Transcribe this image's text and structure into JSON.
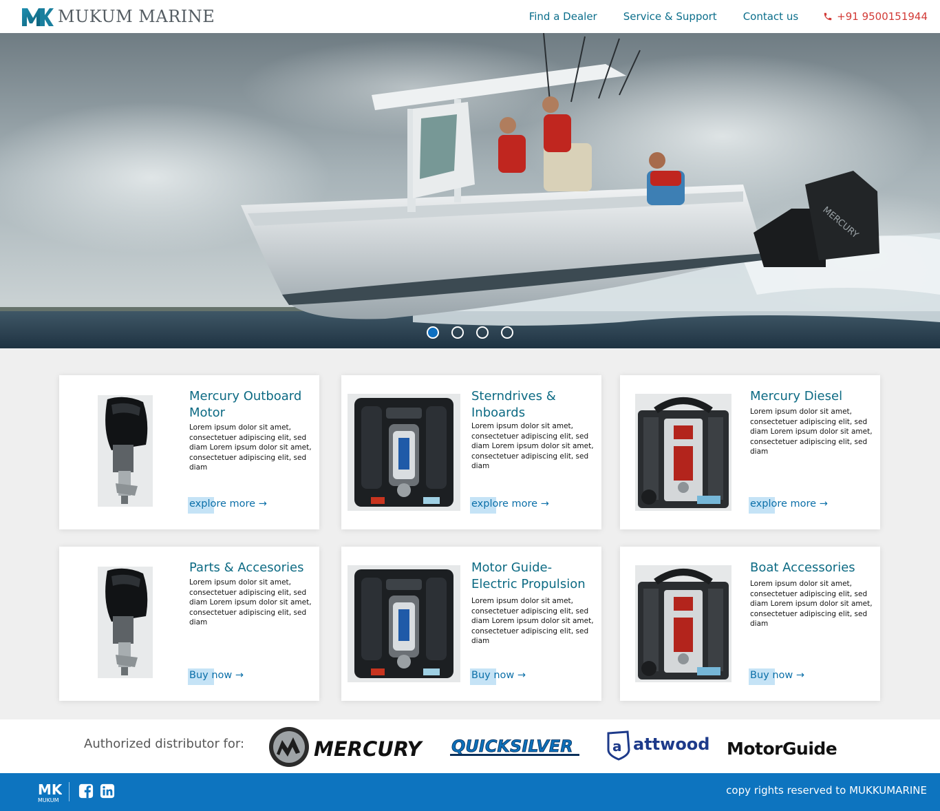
{
  "header": {
    "brand": "MUKUM MARINE",
    "nav": [
      "Find a Dealer",
      "Service & Support",
      "Contact us"
    ],
    "phone": "+91 9500151944"
  },
  "hero": {
    "slide_count": 4,
    "active_slide": 1,
    "engine_brand_text": "MERCURY"
  },
  "cards": [
    {
      "title": "Mercury Outboard Motor",
      "desc": "Lorem ipsum dolor sit amet, consectetuer adipiscing elit, sed diam Lorem ipsum dolor sit amet, consectetuer adipiscing elit, sed diam",
      "cta": "explore more →",
      "image": "outboard-motor"
    },
    {
      "title": "Sterndrives & Inboards",
      "desc": "Lorem ipsum dolor sit amet, consectetuer adipiscing elit, sed diam Lorem ipsum dolor sit amet, consectetuer adipiscing elit, sed diam",
      "cta": "explore more →",
      "image": "v8-engine"
    },
    {
      "title": "Mercury Diesel",
      "desc": "Lorem ipsum dolor sit amet, consectetuer adipiscing elit, sed diam Lorem ipsum dolor sit amet, consectetuer adipiscing elit, sed diam",
      "cta": "explore more →",
      "image": "diesel-engine"
    },
    {
      "title": "Parts & Accesories",
      "desc": "Lorem ipsum dolor sit amet, consectetuer adipiscing elit, sed diam Lorem ipsum dolor sit amet, consectetuer adipiscing elit, sed diam",
      "cta": "Buy now →",
      "image": "outboard-motor"
    },
    {
      "title": "Motor Guide- Electric Propulsion",
      "desc": "Lorem ipsum dolor sit amet, consectetuer adipiscing elit, sed diam Lorem ipsum dolor sit amet, consectetuer adipiscing elit, sed diam",
      "cta": "Buy now →",
      "image": "v8-engine"
    },
    {
      "title": "Boat Accessories",
      "desc": "Lorem ipsum dolor sit amet, consectetuer adipiscing elit, sed diam Lorem ipsum dolor sit amet, consectetuer adipiscing elit, sed diam",
      "cta": "Buy now →",
      "image": "diesel-engine"
    }
  ],
  "distributor": {
    "label": "Authorized distributor for:",
    "brands": [
      "MERCURY",
      "QUICKSILVER",
      "attwood",
      "MotorGuide"
    ]
  },
  "footer": {
    "logo_letters": "MK",
    "logo_sub": "MUKUM",
    "copyright": "copy rights reserved to MUKKUMARINE"
  },
  "colors": {
    "accent_teal": "#0c6a83",
    "link_blue": "#0b6fa8",
    "footer_blue": "#0d74bf",
    "phone_red": "#d23a36"
  }
}
